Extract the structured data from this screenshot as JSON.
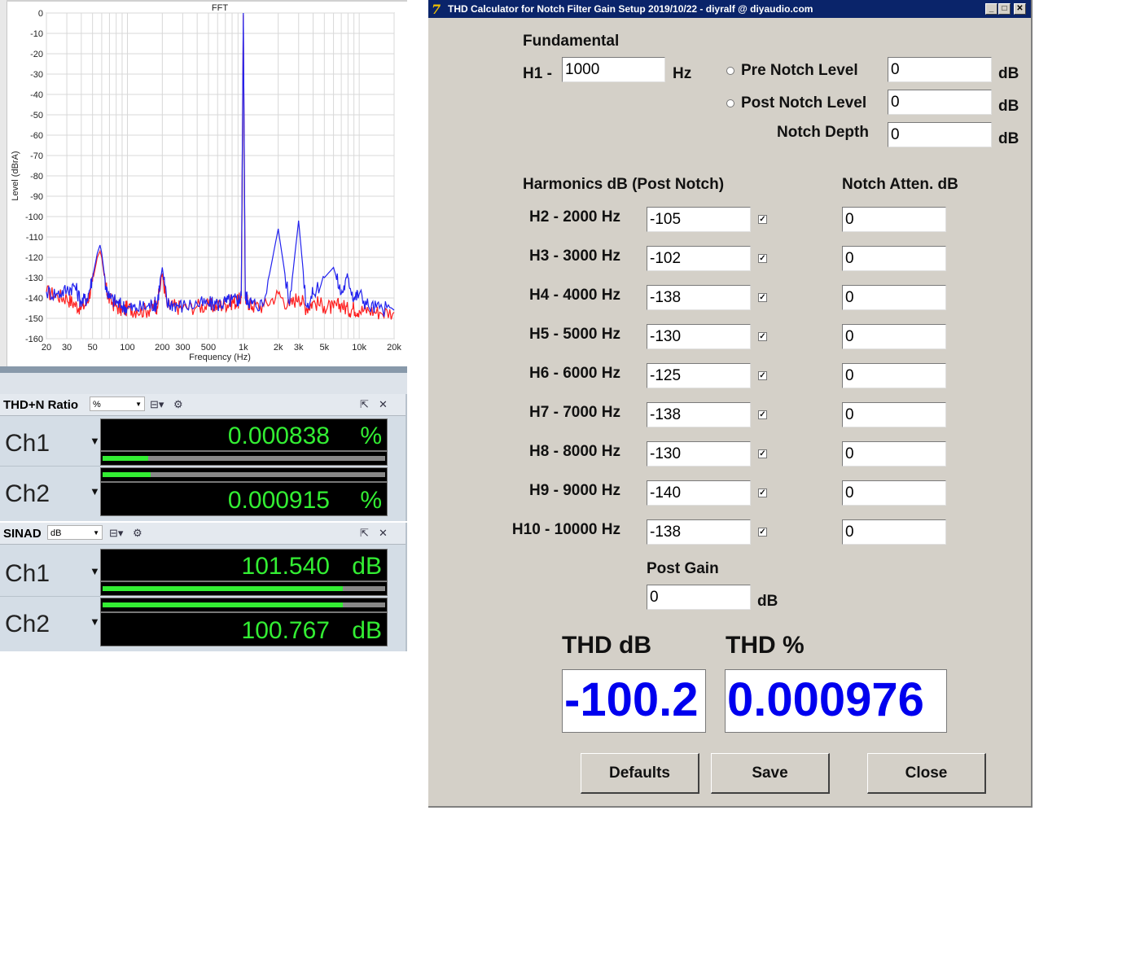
{
  "fft": {
    "title": "FFT",
    "ylabel": "Level (dBrA)",
    "xlabel": "Frequency (Hz)"
  },
  "chart_data": {
    "type": "line",
    "title": "FFT",
    "xlabel": "Frequency (Hz)",
    "ylabel": "Level (dBrA)",
    "xscale": "log",
    "xlim": [
      20,
      20000
    ],
    "ylim": [
      -160,
      0
    ],
    "grid": true,
    "xticks": [
      {
        "v": 20,
        "label": "20"
      },
      {
        "v": 30,
        "label": "30"
      },
      {
        "v": 50,
        "label": "50"
      },
      {
        "v": 100,
        "label": "100"
      },
      {
        "v": 200,
        "label": "200"
      },
      {
        "v": 300,
        "label": "300"
      },
      {
        "v": 500,
        "label": "500"
      },
      {
        "v": 1000,
        "label": "1k"
      },
      {
        "v": 2000,
        "label": "2k"
      },
      {
        "v": 3000,
        "label": "3k"
      },
      {
        "v": 5000,
        "label": "5k"
      },
      {
        "v": 10000,
        "label": "10k"
      },
      {
        "v": 20000,
        "label": "20k"
      }
    ],
    "yticks": [
      0,
      -10,
      -20,
      -30,
      -40,
      -50,
      -60,
      -70,
      -80,
      -90,
      -100,
      -110,
      -120,
      -130,
      -140,
      -150,
      -160
    ],
    "series": [
      {
        "color": "#ff2020",
        "x": [
          20,
          25,
          30,
          35,
          40,
          45,
          50,
          55,
          58,
          60,
          65,
          70,
          80,
          90,
          100,
          120,
          150,
          170,
          180,
          200,
          220,
          250,
          300,
          400,
          500,
          600,
          700,
          800,
          900,
          960,
          1000,
          1040,
          1100,
          1200,
          1500,
          2000,
          2500,
          3000,
          3500,
          4000,
          5000,
          6000,
          7000,
          8000,
          9000,
          10000,
          12000,
          15000,
          20000
        ],
        "y": [
          -137,
          -139,
          -140,
          -143,
          -145,
          -142,
          -132,
          -120,
          -117,
          -120,
          -135,
          -141,
          -144,
          -146,
          -145,
          -146,
          -146,
          -144,
          -144,
          -128,
          -144,
          -144,
          -145,
          -144,
          -144,
          -144,
          -143,
          -142,
          -142,
          -140,
          -1,
          -140,
          -142,
          -144,
          -144,
          -138,
          -144,
          -139,
          -145,
          -142,
          -144,
          -145,
          -143,
          -146,
          -145,
          -146,
          -146,
          -147,
          -147
        ]
      },
      {
        "color": "#2222ee",
        "x": [
          20,
          25,
          30,
          35,
          40,
          45,
          50,
          55,
          58,
          60,
          65,
          70,
          80,
          90,
          100,
          120,
          150,
          170,
          180,
          200,
          220,
          250,
          300,
          400,
          500,
          600,
          700,
          800,
          900,
          960,
          1000,
          1040,
          1100,
          1200,
          1500,
          2000,
          2500,
          3000,
          3500,
          4000,
          5000,
          6000,
          7000,
          8000,
          9000,
          10000,
          12000,
          15000,
          20000
        ],
        "y": [
          -137,
          -138,
          -136,
          -134,
          -142,
          -140,
          -130,
          -118,
          -114,
          -118,
          -134,
          -140,
          -142,
          -144,
          -145,
          -145,
          -144,
          -143,
          -143,
          -125,
          -143,
          -143,
          -144,
          -143,
          -143,
          -143,
          -142,
          -141,
          -141,
          -139,
          0,
          -139,
          -141,
          -143,
          -143,
          -106,
          -143,
          -102,
          -144,
          -138,
          -130,
          -125,
          -138,
          -130,
          -140,
          -138,
          -144,
          -145,
          -146
        ]
      }
    ]
  },
  "thdn": {
    "title": "THD+N Ratio",
    "unit_select": "%",
    "ch1": {
      "label": "Ch1",
      "value": "0.000838",
      "unit": "%",
      "level": 0.16
    },
    "ch2": {
      "label": "Ch2",
      "value": "0.000915",
      "unit": "%",
      "level": 0.17
    }
  },
  "sinad": {
    "title": "SINAD",
    "unit_select": "dB",
    "ch1": {
      "label": "Ch1",
      "value": "101.540",
      "unit": "dB",
      "level": 0.85
    },
    "ch2": {
      "label": "Ch2",
      "value": "100.767",
      "unit": "dB",
      "level": 0.85
    }
  },
  "calc": {
    "window_title": "THD Calculator for Notch Filter Gain Setup 2019/10/22 - diyralf @ diyaudio.com",
    "fundamental_label": "Fundamental",
    "h1_label": "H1 -",
    "h1_value": "1000",
    "hz_unit": "Hz",
    "db_unit": "dB",
    "pre_notch_label": "Pre Notch Level",
    "pre_notch_value": "0",
    "post_notch_label": "Post Notch Level",
    "post_notch_value": "0",
    "notch_depth_label": "Notch Depth",
    "notch_depth_value": "0",
    "harmonics_header": "Harmonics dB (Post Notch)",
    "atten_header": "Notch Atten. dB",
    "harmonics": [
      {
        "label": "H2 - 2000 Hz",
        "value": "-105",
        "atten": "0",
        "checked": true
      },
      {
        "label": "H3 - 3000 Hz",
        "value": "-102",
        "atten": "0",
        "checked": true
      },
      {
        "label": "H4 - 4000 Hz",
        "value": "-138",
        "atten": "0",
        "checked": true
      },
      {
        "label": "H5 - 5000 Hz",
        "value": "-130",
        "atten": "0",
        "checked": true
      },
      {
        "label": "H6 - 6000 Hz",
        "value": "-125",
        "atten": "0",
        "checked": true
      },
      {
        "label": "H7 - 7000 Hz",
        "value": "-138",
        "atten": "0",
        "checked": true
      },
      {
        "label": "H8 - 8000 Hz",
        "value": "-130",
        "atten": "0",
        "checked": true
      },
      {
        "label": "H9 - 9000 Hz",
        "value": "-140",
        "atten": "0",
        "checked": true
      },
      {
        "label": "H10 - 10000 Hz",
        "value": "-138",
        "atten": "0",
        "checked": true
      }
    ],
    "post_gain_label": "Post Gain",
    "post_gain_value": "0",
    "thd_db_label": "THD dB",
    "thd_pct_label": "THD %",
    "thd_db_value": "-100.2",
    "thd_pct_value": "0.000976",
    "defaults_label": "Defaults",
    "save_label": "Save",
    "close_label": "Close"
  }
}
